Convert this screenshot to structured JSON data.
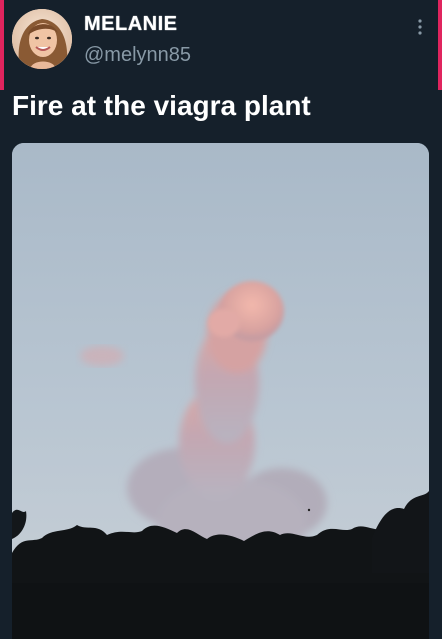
{
  "tweet": {
    "author": {
      "display_name": "MELANIE",
      "handle": "@melynn85",
      "avatar_icon": "avatar-photo"
    },
    "more_icon": "more-vertical-icon",
    "text": "Fire at the viagra plant",
    "media": {
      "type": "photo"
    }
  },
  "colors": {
    "background": "#15202b",
    "accent": "#e0245e",
    "text_primary": "#ffffff",
    "text_secondary": "#8899a6"
  }
}
